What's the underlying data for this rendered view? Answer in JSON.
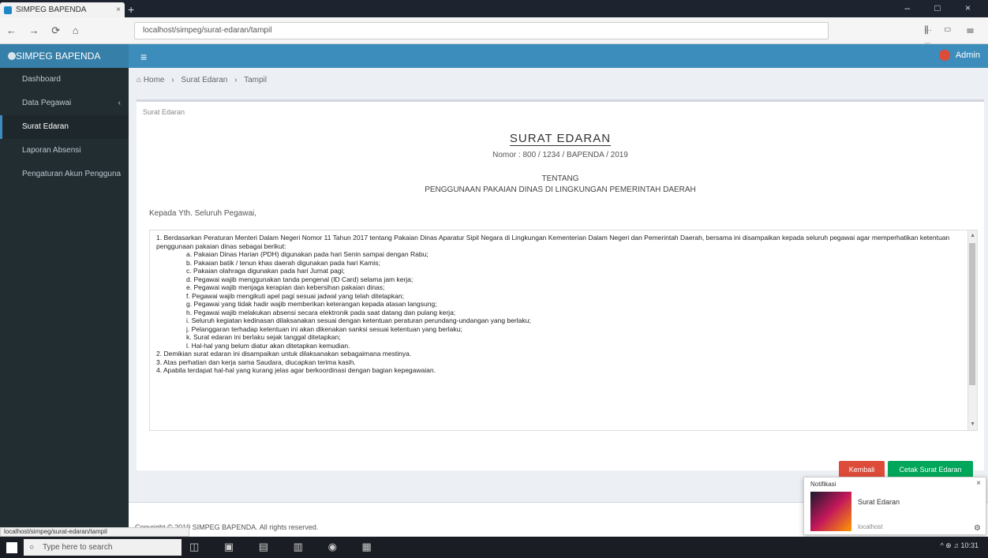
{
  "browser": {
    "tab_title": "SIMPEG BAPENDA",
    "tab_close": "×",
    "new_tab": "+",
    "window_controls": "– □ ×",
    "nav_buttons": "← → ⟳ ⌂",
    "url": "localhost/simpeg/surat-edaran/tampil",
    "url_right": "··· ♡ ☆",
    "toolbar_icons": "⫼ ▭ ☰"
  },
  "header": {
    "brand": "SIMPEG BAPENDA",
    "menu_icon": "≡",
    "user_name": "Admin"
  },
  "sidebar": {
    "items": [
      {
        "label": "Dashboard"
      },
      {
        "label": "Data Pegawai",
        "chevron": "‹"
      },
      {
        "label": "Surat Edaran"
      },
      {
        "label": "Laporan Absensi"
      },
      {
        "label": "Pengaturan Akun Pengguna"
      }
    ]
  },
  "breadcrumb": {
    "home": "⌂ Home",
    "sep1": "›",
    "section": "Surat Edaran",
    "sep2": "›",
    "page": "Tampil"
  },
  "document": {
    "box_label": "Surat Edaran",
    "title": "SURAT EDARAN",
    "number": "Nomor : 800 / 1234 / BAPENDA / 2019",
    "tentang": "TENTANG",
    "subject": "PENGGUNAAN PAKAIAN DINAS DI LINGKUNGAN PEMERINTAH DAERAH",
    "salutation": "Kepada Yth. Seluruh Pegawai,",
    "paragraphs": [
      "1. Berdasarkan Peraturan Menteri Dalam Negeri Nomor 11 Tahun 2017 tentang Pakaian Dinas Aparatur Sipil Negara di Lingkungan Kementerian Dalam Negeri dan Pemerintah Daerah, bersama ini disampaikan kepada seluruh pegawai agar memperhatikan ketentuan penggunaan pakaian dinas sebagai berikut:",
      "a. Pakaian Dinas Harian (PDH) digunakan pada hari Senin sampai dengan Rabu;",
      "b. Pakaian batik / tenun khas daerah digunakan pada hari Kamis;",
      "c. Pakaian olahraga digunakan pada hari Jumat pagi;",
      "d. Pegawai wajib menggunakan tanda pengenal (ID Card) selama jam kerja;",
      "e. Pegawai wajib menjaga kerapian dan kebersihan pakaian dinas;",
      "f. Pegawai wajib mengikuti apel pagi sesuai jadwal yang telah ditetapkan;",
      "g. Pegawai yang tidak hadir wajib memberikan keterangan kepada atasan langsung;",
      "h. Pegawai wajib melakukan absensi secara elektronik pada saat datang dan pulang kerja;",
      "i. Seluruh kegiatan kedinasan dilaksanakan sesuai dengan ketentuan peraturan perundang-undangan yang berlaku;",
      "j. Pelanggaran terhadap ketentuan ini akan dikenakan sanksi sesuai ketentuan yang berlaku;",
      "k. Surat edaran ini berlaku sejak tanggal ditetapkan;",
      "l. Hal-hal yang belum diatur akan ditetapkan kemudian.",
      "2. Demikian surat edaran ini disampaikan untuk dilaksanakan sebagaimana mestinya.",
      "3. Atas perhatian dan kerja sama Saudara, diucapkan terima kasih.",
      "4. Apabila terdapat hal-hal yang kurang jelas agar berkoordinasi dengan bagian kepegawaian."
    ],
    "btn_back": "Kembali",
    "btn_print": "Cetak Surat Edaran",
    "footer": "Copyright © 2019 SIMPEG BAPENDA. All rights reserved."
  },
  "statusbar": "localhost/simpeg/surat-edaran/tampil",
  "notification": {
    "title": "Notifikasi",
    "body": "Surat Edaran",
    "sub": "localhost",
    "close": "×",
    "gear": "⚙"
  },
  "taskbar": {
    "search_placeholder": "Type here to search",
    "apps": "◫ ▣ ▤ ▥ ◉ ▦",
    "tray": "^ ⊕ ♫ 10:31"
  }
}
